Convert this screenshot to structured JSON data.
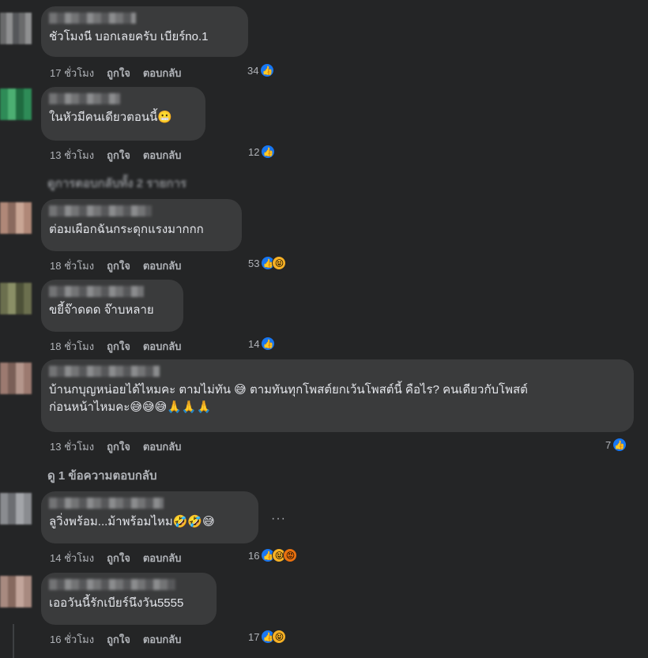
{
  "comments": [
    {
      "text": "ชัวโมงนี บอกเลยครับ เบียร์no.1",
      "time": "17 ชั่วโมง",
      "like": "ถูกใจ",
      "reply": "ตอบกลับ",
      "count": "34"
    },
    {
      "text": "ในหัวมีคนเดียวตอนนี้😬",
      "time": "13 ชั่วโมง",
      "like": "ถูกใจ",
      "reply": "ตอบกลับ",
      "count": "12"
    },
    {
      "text": "ต่อมเผือกฉันกระดุกแรงมากกก",
      "time": "18 ชั่วโมง",
      "like": "ถูกใจ",
      "reply": "ตอบกลับ",
      "count": "53"
    },
    {
      "text": "ขยี้จ๊าดดด จ๊าบหลาย",
      "time": "18 ชั่วโมง",
      "like": "ถูกใจ",
      "reply": "ตอบกลับ",
      "count": "14"
    },
    {
      "text": "บ้านกบุญหน่อยได้ไหมคะ ตามไม่ทัน 😅 ตามทันทุกโพสต์ยกเว้นโพสต์นี้ คือไร? คนเดียวกับโพสต์\nก่อนหน้าไหมคะ😅😅😅🙏🙏🙏",
      "time": "13 ชั่วโมง",
      "like": "ถูกใจ",
      "reply": "ตอบกลับ",
      "count": "7"
    },
    {
      "text": "ลูวิ่งพร้อม...ม้าพร้อมไหม🤣🤣😅",
      "time": "14 ชั่วโมง",
      "like": "ถูกใจ",
      "reply": "ตอบกลับ",
      "count": "16"
    },
    {
      "text": "เออวันนี้รักเบียร์นึงวัน5555",
      "time": "16 ชั่วโมง",
      "like": "ถูกใจ",
      "reply": "ตอบกลับ",
      "count": "17"
    }
  ],
  "replies_link_1": "ดูการตอบกลับทั้ง 2 รายการ",
  "replies_link_2": "ดู 1 ข้อความตอบกลับ",
  "more_icon": "···",
  "colors": {
    "like": "#1877f2",
    "haha": "#f7b125",
    "bg": "#242526",
    "bubble": "#3a3b3c"
  }
}
